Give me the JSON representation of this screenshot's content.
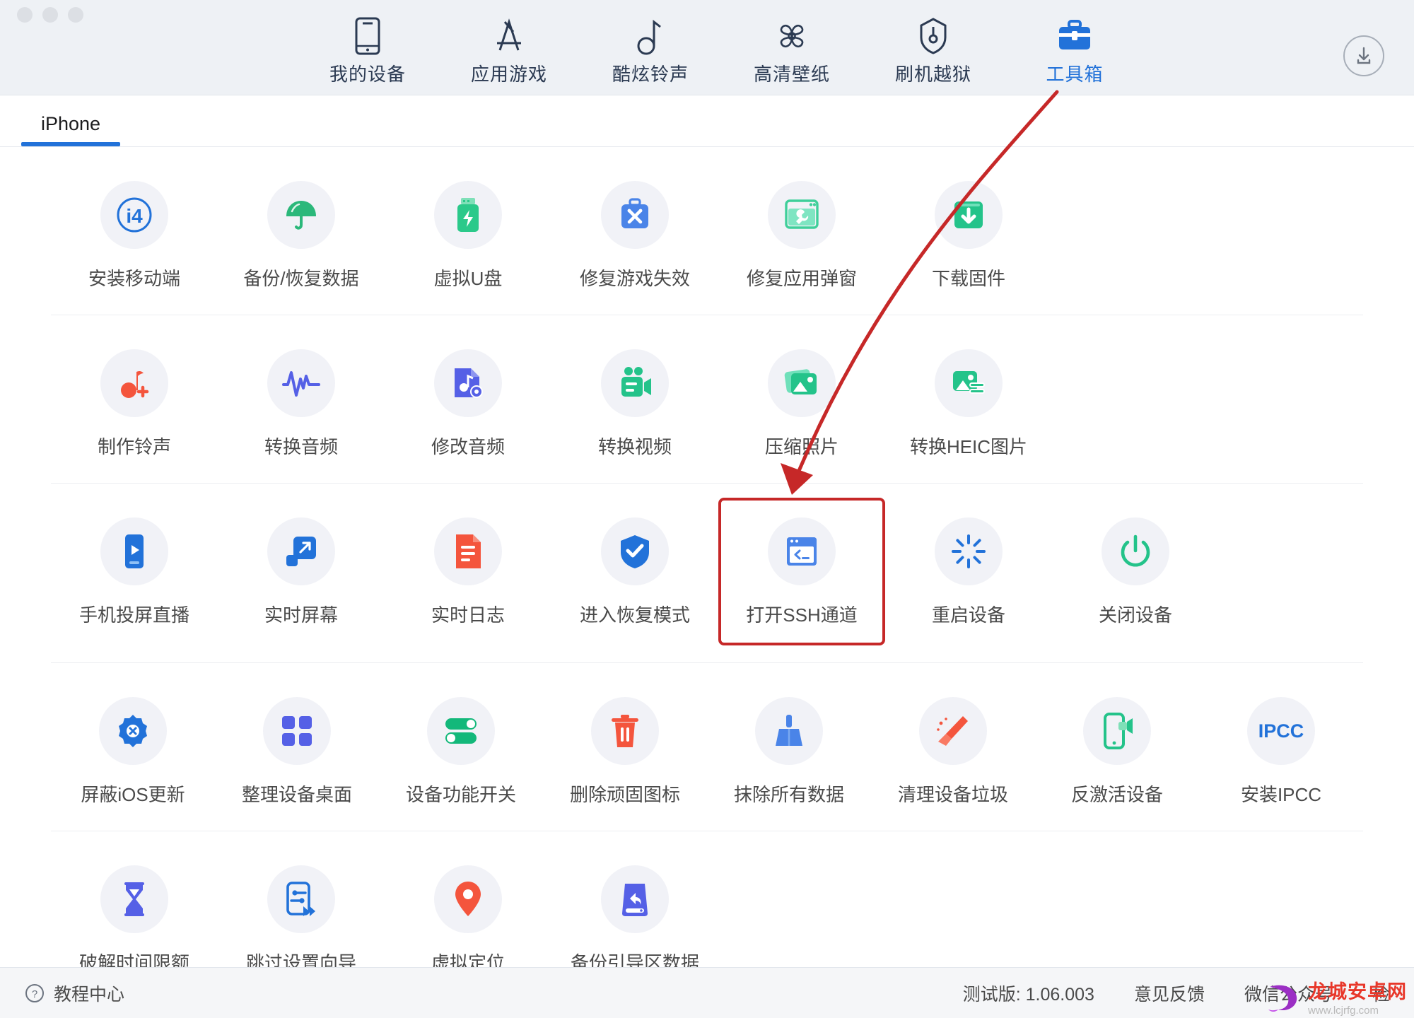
{
  "window": {
    "traffic_lights": [
      "close",
      "minimize",
      "maximize"
    ]
  },
  "nav": {
    "items": [
      {
        "label": "我的设备",
        "icon": "phone-icon",
        "active": false
      },
      {
        "label": "应用游戏",
        "icon": "appstore-icon",
        "active": false
      },
      {
        "label": "酷炫铃声",
        "icon": "music-note-icon",
        "active": false
      },
      {
        "label": "高清壁纸",
        "icon": "flower-icon",
        "active": false
      },
      {
        "label": "刷机越狱",
        "icon": "shield-pin-icon",
        "active": false
      },
      {
        "label": "工具箱",
        "icon": "toolbox-icon",
        "active": true
      }
    ],
    "download_button": "download-icon"
  },
  "tabs": [
    {
      "label": "iPhone",
      "active": true
    }
  ],
  "grid": {
    "rows": [
      {
        "items": [
          {
            "label": "安装移动端",
            "icon": "i4-logo-icon",
            "color": "#2272d9"
          },
          {
            "label": "备份/恢复数据",
            "icon": "umbrella-icon",
            "color": "#2bb87a"
          },
          {
            "label": "虚拟U盘",
            "icon": "usb-flash-icon",
            "color": "#2bc98a"
          },
          {
            "label": "修复游戏失效",
            "icon": "toolbox-wrench-icon",
            "color": "#4a84e8"
          },
          {
            "label": "修复应用弹窗",
            "icon": "window-wrench-icon",
            "color": "#3fcf9a"
          },
          {
            "label": "下载固件",
            "icon": "download-box-icon",
            "color": "#24c38a"
          }
        ]
      },
      {
        "items": [
          {
            "label": "制作铃声",
            "icon": "music-plus-icon",
            "color": "#f4553d"
          },
          {
            "label": "转换音频",
            "icon": "waveform-icon",
            "color": "#5560e6"
          },
          {
            "label": "修改音频",
            "icon": "audio-file-gear-icon",
            "color": "#5560e6"
          },
          {
            "label": "转换视频",
            "icon": "video-camera-icon",
            "color": "#24c38a"
          },
          {
            "label": "压缩照片",
            "icon": "photo-stack-icon",
            "color": "#24c38a"
          },
          {
            "label": "转换HEIC图片",
            "icon": "photo-convert-icon",
            "color": "#24c38a"
          }
        ]
      },
      {
        "items": [
          {
            "label": "手机投屏直播",
            "icon": "phone-play-icon",
            "color": "#2272d9"
          },
          {
            "label": "实时屏幕",
            "icon": "screen-expand-icon",
            "color": "#2272d9"
          },
          {
            "label": "实时日志",
            "icon": "log-file-icon",
            "color": "#f4553d"
          },
          {
            "label": "进入恢复模式",
            "icon": "shield-check-icon",
            "color": "#2272d9"
          },
          {
            "label": "打开SSH通道",
            "icon": "terminal-icon",
            "color": "#4a84e8",
            "highlighted": true
          },
          {
            "label": "重启设备",
            "icon": "restart-spinner-icon",
            "color": "#2272d9"
          },
          {
            "label": "关闭设备",
            "icon": "power-icon",
            "color": "#24c38a"
          }
        ]
      },
      {
        "items": [
          {
            "label": "屏蔽iOS更新",
            "icon": "gear-block-icon",
            "color": "#2272d9"
          },
          {
            "label": "整理设备桌面",
            "icon": "grid-squares-icon",
            "color": "#5560e6"
          },
          {
            "label": "设备功能开关",
            "icon": "toggles-icon",
            "color": "#13b87a"
          },
          {
            "label": "删除顽固图标",
            "icon": "trash-icon",
            "color": "#f4553d"
          },
          {
            "label": "抹除所有数据",
            "icon": "broom-icon",
            "color": "#4a84e8"
          },
          {
            "label": "清理设备垃圾",
            "icon": "sweep-broom-icon",
            "color": "#f4553d"
          },
          {
            "label": "反激活设备",
            "icon": "phone-deactivate-icon",
            "color": "#24c38a"
          },
          {
            "label": "安装IPCC",
            "icon": "ipcc-text-icon",
            "color": "#2272d9",
            "text_icon": "IPCC"
          }
        ]
      },
      {
        "items": [
          {
            "label": "破解时间限额",
            "icon": "hourglass-icon",
            "color": "#5560e6"
          },
          {
            "label": "跳过设置向导",
            "icon": "skip-setup-icon",
            "color": "#2272d9"
          },
          {
            "label": "虚拟定位",
            "icon": "map-pin-icon",
            "color": "#f4553d"
          },
          {
            "label": "备份引导区数据",
            "icon": "disk-restore-icon",
            "color": "#5560e6"
          }
        ]
      }
    ]
  },
  "footer": {
    "help_icon": "question-circle-icon",
    "help_label": "教程中心",
    "version": "测试版: 1.06.003",
    "links": [
      "意见反馈",
      "微信公众号",
      "检"
    ]
  },
  "annotation": {
    "arrow_color": "#c62828",
    "highlight_box_color": "#c62828"
  },
  "watermark": {
    "main": "龙城安卓网",
    "sub": "www.lcjrfg.com"
  }
}
